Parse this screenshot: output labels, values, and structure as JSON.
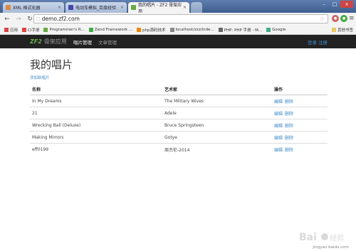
{
  "browser": {
    "tabs": [
      {
        "title": "XML 格式化器",
        "active": false,
        "color": "#d84"
      },
      {
        "title": "电动车模拟_百度经验",
        "active": false,
        "color": "#44a"
      },
      {
        "title": "我的唱片 - ZF2 骨架应用",
        "active": true,
        "color": "#6a4"
      }
    ],
    "close_glyph": "×",
    "window_controls": [
      "–",
      "□",
      "×"
    ],
    "address": {
      "host": "demo.zf2.com",
      "lock_glyph": "⬚"
    },
    "bookmarks": [
      {
        "label": "应用",
        "icon_color": "#d44"
      },
      {
        "label": "CI手册",
        "icon_color": "#d44"
      },
      {
        "label": "Programmer's R...",
        "icon_color": "#6a4"
      },
      {
        "label": "Zend Framework ...",
        "icon_color": "#4a4"
      },
      {
        "label": "php源码技术",
        "icon_color": "#e80"
      },
      {
        "label": "localhost/zzz/inde...",
        "icon_color": "#888"
      },
      {
        "label": "PHP: PHP 手册 - M...",
        "icon_color": "#666"
      },
      {
        "label": "Google",
        "icon_color": "#4a8"
      }
    ],
    "other_bookmarks": "其他书签",
    "colors": {
      "accent": "#428bca",
      "nav_bg": "#222222"
    }
  },
  "app": {
    "brand_logo": "ZF2",
    "brand_name": "骨架应用",
    "nav": [
      {
        "label": "唱片管理",
        "active": true
      },
      {
        "label": "文章管理",
        "active": false
      }
    ],
    "login": "登录",
    "register": "注册"
  },
  "page": {
    "title": "我的唱片",
    "add_link": "添加新唱片",
    "table": {
      "headers": [
        "名称",
        "艺术家",
        "操作"
      ],
      "rows": [
        {
          "title": "In My Dreams",
          "artist": "The Military Wives"
        },
        {
          "title": "21",
          "artist": "Adele"
        },
        {
          "title": "Wrecking Ball (Deluxe)",
          "artist": "Bruce Springsteen"
        },
        {
          "title": "Making Mirrors",
          "artist": "Gotye"
        },
        {
          "title": "eff0199",
          "artist": "周杰伦-2014"
        }
      ],
      "edit_label": "编辑",
      "delete_label": "删除"
    }
  },
  "watermark": {
    "text": "jingyan.baidu.com",
    "logo": "Baidu 经验"
  }
}
